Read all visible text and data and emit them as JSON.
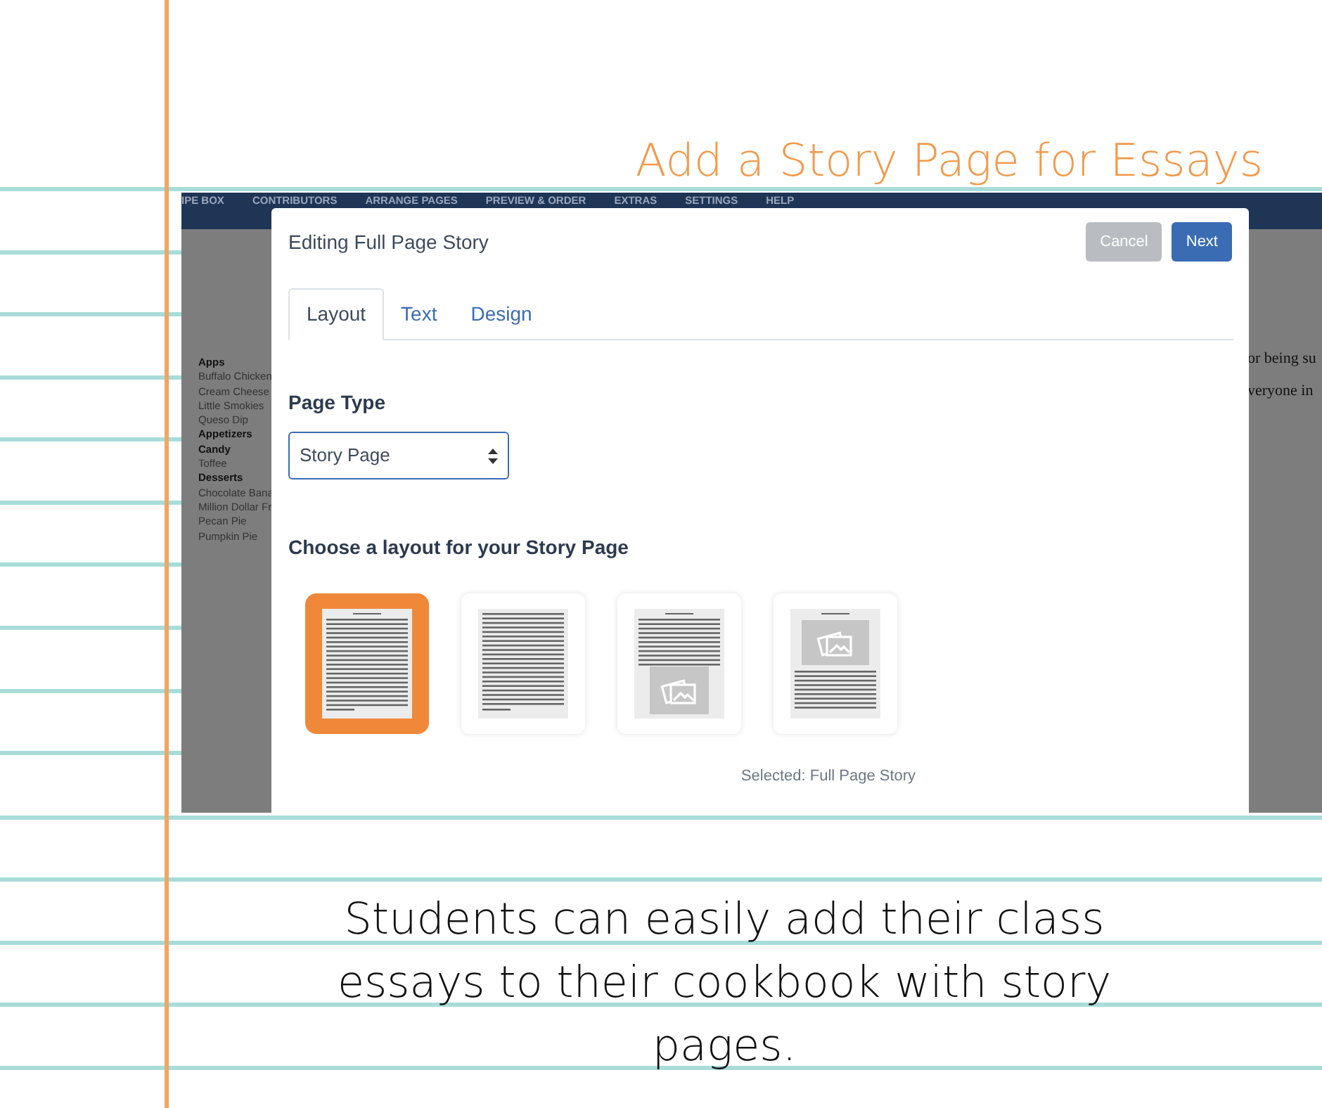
{
  "title": "Add a Story Page for Essays",
  "screenshot": {
    "nav_items": [
      "IPE BOX",
      "CONTRIBUTORS",
      "ARRANGE PAGES",
      "PREVIEW & ORDER",
      "EXTRAS",
      "SETTINGS",
      "HELP"
    ],
    "sidebar_items": [
      {
        "label": "Apps",
        "kind": "heading"
      },
      {
        "label": "Buffalo Chicken",
        "kind": "item"
      },
      {
        "label": "Cream Cheese",
        "kind": "item"
      },
      {
        "label": "Little Smokies",
        "kind": "item"
      },
      {
        "label": "Queso Dip",
        "kind": "item"
      },
      {
        "label": "Appetizers",
        "kind": "heading"
      },
      {
        "label": "Candy",
        "kind": "heading"
      },
      {
        "label": "Toffee",
        "kind": "item"
      },
      {
        "label": "Desserts",
        "kind": "heading"
      },
      {
        "label": "Chocolate  Bana",
        "kind": "item"
      },
      {
        "label": "Million Dollar Fr",
        "kind": "item"
      },
      {
        "label": "Pecan Pie",
        "kind": "item"
      },
      {
        "label": "Pumpkin Pie",
        "kind": "item"
      }
    ],
    "background_text": [
      "or being su",
      "veryone in"
    ],
    "modal": {
      "title": "Editing Full Page Story",
      "buttons": [
        {
          "label": "Cancel",
          "kind": "secondary"
        },
        {
          "label": "Next",
          "kind": "primary"
        }
      ],
      "tabs": [
        {
          "label": "Layout",
          "selected": true
        },
        {
          "label": "Text",
          "selected": false
        },
        {
          "label": "Design",
          "selected": false
        }
      ],
      "page_type_label": "Page Type",
      "page_type_value": "Story Page",
      "layout_heading": "Choose a layout for your Story Page",
      "layouts": [
        {
          "kind": "titled-text",
          "selected": true
        },
        {
          "kind": "text",
          "selected": false
        },
        {
          "kind": "image-below",
          "selected": false
        },
        {
          "kind": "image-above",
          "selected": false
        }
      ],
      "selected_caption": "Selected: Full Page Story"
    }
  },
  "caption": "Students can easily add their class essays to their cookbook with story pages."
}
